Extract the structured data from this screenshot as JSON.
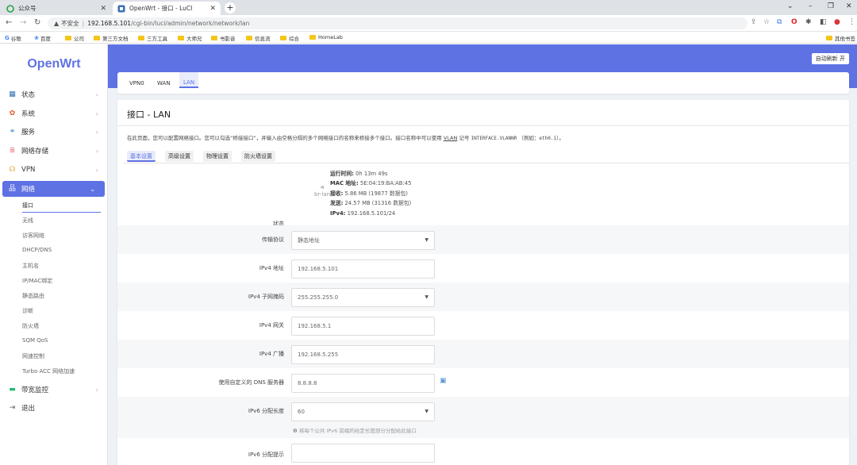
{
  "browser": {
    "tabs": [
      {
        "title": "公众号",
        "icon": "wechat-icon"
      },
      {
        "title": "OpenWrt - 接口 - LuCI",
        "icon": "openwrt-icon"
      }
    ],
    "security_label": "不安全",
    "url_host": "192.168.5.101",
    "url_path": "/cgi-bin/luci/admin/network/network/lan",
    "bookmarks": [
      "谷歌",
      "百度",
      "公司",
      "第三方文档",
      "三方工具",
      "大师兄",
      "书影音",
      "信息流",
      "综合",
      "HomeLab"
    ],
    "other_bookmarks": "其他书签"
  },
  "sidebar": {
    "logo": "OpenWrt",
    "items": [
      {
        "label": "状态",
        "icon": "status-icon",
        "color": "#2f6fb5"
      },
      {
        "label": "系统",
        "icon": "gear-icon",
        "color": "#e0572f"
      },
      {
        "label": "服务",
        "icon": "services-icon",
        "color": "#3b8ed6"
      },
      {
        "label": "网络存储",
        "icon": "storage-icon",
        "color": "#e66a6a"
      },
      {
        "label": "VPN",
        "icon": "vpn-icon",
        "color": "#e0a52f"
      },
      {
        "label": "网络",
        "icon": "network-icon",
        "color": "#ffffff"
      }
    ],
    "network_sub": [
      "接口",
      "无线",
      "访客网络",
      "DHCP/DNS",
      "主机名",
      "IP/MAC绑定",
      "静态路由",
      "诊断",
      "防火墙",
      "SQM QoS",
      "网速控制",
      "Turbo ACC 网络加速"
    ],
    "bottom_items": [
      {
        "label": "带宽监控",
        "icon": "bandwidth-icon",
        "color": "#2bb673"
      },
      {
        "label": "退出",
        "icon": "logout-icon",
        "color": "#666666"
      }
    ]
  },
  "header": {
    "auto_refresh": "自动刷新 开"
  },
  "iface_tabs": [
    "VPN0",
    "WAN",
    "LAN"
  ],
  "main": {
    "title": "接口 - LAN",
    "desc_prefix": "在此页面，您可以配置网络接口。您可以勾选“桥接接口”，并输入由空格分隔的多个网络接口的名称来桥接多个接口。接口名称中可以使用",
    "desc_vlan": "VLAN",
    "desc_middle": "记号",
    "desc_mono": "INTERFACE.VLANNR",
    "desc_example_prefix": "（例如：",
    "desc_example": "eth0.1",
    "desc_suffix": "）。",
    "subtabs": [
      "基本设置",
      "高级设置",
      "物理设置",
      "防火墙设置"
    ],
    "status": {
      "label": "状态",
      "icon": "ethernet-icon",
      "device": "br-lan",
      "uptime_label": "运行时间:",
      "uptime": "0h 13m 49s",
      "mac_label": "MAC 地址:",
      "mac": "5E:04:19:BA:AB:45",
      "rx_label": "接收:",
      "rx": "5.86 MB (19877 数据包)",
      "tx_label": "发送:",
      "tx": "24.57 MB (31316 数据包)",
      "ipv4_label": "IPv4:",
      "ipv4": "192.168.5.101/24"
    },
    "fields": [
      {
        "label": "传输协议",
        "value": "静态地址",
        "select": true
      },
      {
        "label": "IPv4 地址",
        "value": "192.168.5.101",
        "select": false
      },
      {
        "label": "IPv4 子网掩码",
        "value": "255.255.255.0",
        "select": true
      },
      {
        "label": "IPv4 网关",
        "value": "192.168.5.1",
        "select": false
      },
      {
        "label": "IPv4 广播",
        "value": "192.168.5.255",
        "select": false
      },
      {
        "label": "使用自定义的 DNS 服务器",
        "value": "8.8.8.8",
        "select": false
      },
      {
        "label": "IPv6 分配长度",
        "value": "60",
        "select": true
      },
      {
        "label": "IPv6 分配提示",
        "value": "",
        "select": false
      }
    ],
    "ipv6_hint": "❷ 将每个公共 IPv6 前缀的给定长度部分分配给此接口"
  }
}
